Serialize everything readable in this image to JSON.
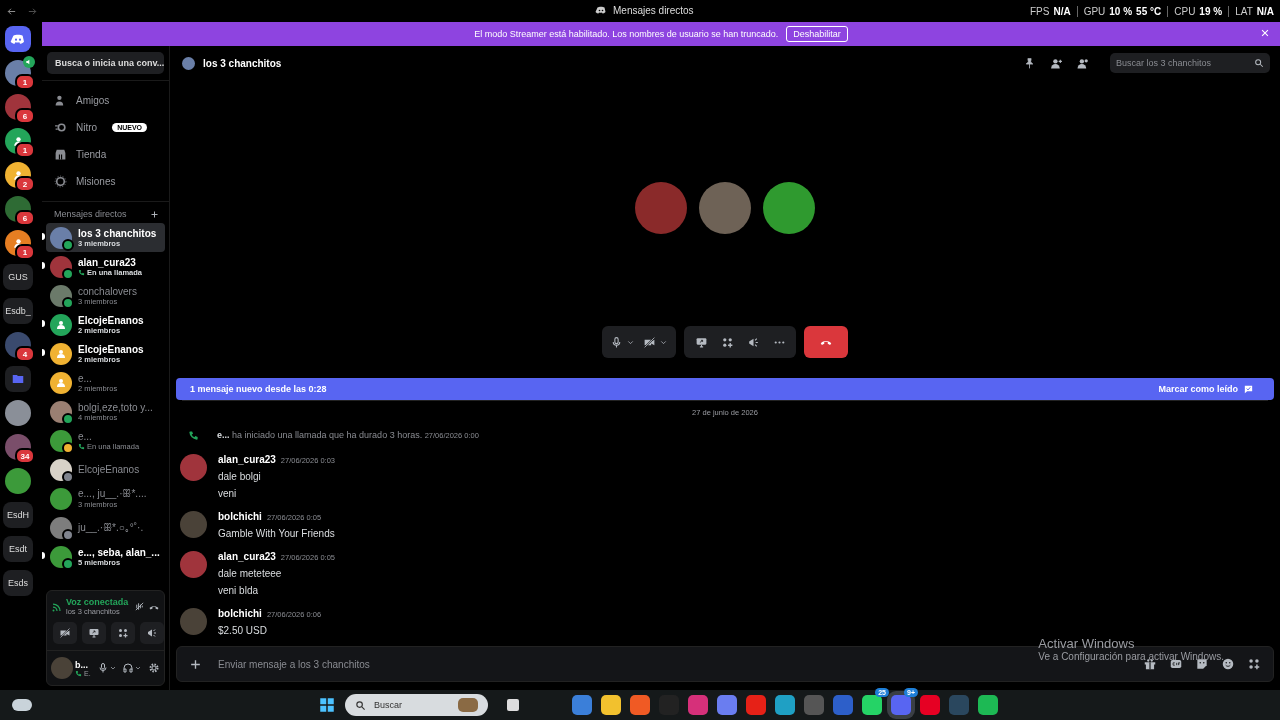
{
  "titlebar": {
    "title": "Mensajes directos",
    "stats": [
      {
        "label": "FPS",
        "values": [
          "N/A"
        ]
      },
      {
        "label": "GPU",
        "values": [
          "10 %",
          "55 °C"
        ]
      },
      {
        "label": "CPU",
        "values": [
          "19 %"
        ]
      },
      {
        "label": "LAT",
        "values": [
          "N/A"
        ]
      }
    ]
  },
  "banner": {
    "text": "El modo Streamer está habilitado. Los nombres de usuario se han truncado.",
    "button": "Deshabilitar"
  },
  "servers": [
    {
      "kind": "home",
      "selected": true
    },
    {
      "kind": "photo",
      "color": "#6a7fa8",
      "badge": "1",
      "voice": true,
      "selected": false
    },
    {
      "kind": "photo",
      "color": "#a0343c",
      "badge": "6",
      "selected": false
    },
    {
      "kind": "group",
      "color": "#23a55a",
      "badge": "1",
      "selected": false
    },
    {
      "kind": "group",
      "color": "#f0b232",
      "badge": "2",
      "selected": false
    },
    {
      "kind": "photo",
      "color": "#2e6b34",
      "badge": "6",
      "selected": false
    },
    {
      "kind": "group",
      "color": "#e67e22",
      "badge": "1",
      "selected": false
    },
    {
      "kind": "text",
      "label": "GUS",
      "selected": false
    },
    {
      "kind": "text",
      "label": "Esdb_",
      "selected": false
    },
    {
      "kind": "photo",
      "color": "#3a4a6e",
      "badge": "4",
      "selected": false
    },
    {
      "kind": "folder",
      "color": "#5865f2",
      "selected": false
    },
    {
      "kind": "photo",
      "color": "#8a8f98",
      "selected": false
    },
    {
      "kind": "photo",
      "color": "#7a4e6a",
      "badge": "34",
      "selected": false
    },
    {
      "kind": "photo",
      "color": "#3c9a3a",
      "selected": false
    },
    {
      "kind": "text",
      "label": "EsdH",
      "selected": false
    },
    {
      "kind": "text",
      "label": "Esdt",
      "selected": false
    },
    {
      "kind": "text",
      "label": "Esds",
      "selected": false
    }
  ],
  "dm_sidebar": {
    "search": "Busca o inicia una conv...",
    "nav": [
      {
        "kind": "friends",
        "label": "Amigos"
      },
      {
        "kind": "nitro",
        "label": "Nitro",
        "badge": "NUEVO"
      },
      {
        "kind": "shop",
        "label": "Tienda"
      },
      {
        "kind": "quests",
        "label": "Misiones"
      }
    ],
    "section_title": "Mensajes directos",
    "conversations": [
      {
        "kind": "photo",
        "color": "#6a7fa8",
        "name": "los 3 chanchitos",
        "subtitle": "3 miembros",
        "status_dot": {
          "color": "#23a55a"
        },
        "in_call": false,
        "unread": true,
        "selected": true
      },
      {
        "kind": "photo",
        "color": "#a0343c",
        "name": "alan_cura23",
        "subtitle": "En una llamada",
        "status_dot": {
          "color": "#23a55a"
        },
        "in_call": true,
        "unread": true,
        "selected": false
      },
      {
        "kind": "photo",
        "color": "#6b7a6a",
        "name": "conchalovers",
        "subtitle": "3 miembros",
        "status_dot": {
          "color": "#23a55a"
        },
        "in_call": false,
        "unread": false,
        "selected": false
      },
      {
        "kind": "group",
        "color": "#23a55a",
        "name": "ElcojeEnanos",
        "subtitle": "2 miembros",
        "in_call": false,
        "unread": true,
        "selected": false
      },
      {
        "kind": "group",
        "color": "#f0b232",
        "name": "ElcojeEnanos",
        "subtitle": "2 miembros",
        "in_call": false,
        "unread": true,
        "selected": false
      },
      {
        "kind": "group",
        "color": "#f0b232",
        "name": "e...",
        "subtitle": "2 miembros",
        "in_call": false,
        "unread": false,
        "selected": false
      },
      {
        "kind": "photo",
        "color": "#9a7f72",
        "name": "bolgi,eze,toto y...",
        "subtitle": "4 miembros",
        "status_dot": {
          "color": "#23a55a"
        },
        "in_call": false,
        "unread": false,
        "selected": false
      },
      {
        "kind": "photo",
        "color": "#3c9a3a",
        "name": "e...",
        "subtitle": "En una llamada",
        "status_dot": {
          "color": "#f0b232"
        },
        "in_call": true,
        "unread": false,
        "selected": false
      },
      {
        "kind": "photo",
        "color": "#d8d2c8",
        "name": "ElcojeEnanos",
        "status_dot": {
          "color": "#80848e"
        },
        "unread": false,
        "selected": false
      },
      {
        "kind": "photo",
        "color": "#3c9a3a",
        "name": "e..., ju__.·ꕥ*....",
        "subtitle": "3 miembros",
        "in_call": false,
        "unread": false,
        "selected": false
      },
      {
        "kind": "photo",
        "color": "#7d7d7d",
        "name": "ju__.·ꕥ*.○｡°˚·.",
        "status_dot": {
          "color": "#80848e"
        },
        "unread": false,
        "selected": false
      },
      {
        "kind": "photo",
        "color": "#3c9a3a",
        "name": "e..., seba, alan_...",
        "subtitle": "5 miembros",
        "status_dot": {
          "color": "#23a55a"
        },
        "in_call": false,
        "unread": true,
        "selected": false
      }
    ]
  },
  "voice_panel": {
    "status": "Voz conectada",
    "channel": "los 3 chanchitos"
  },
  "user_panel": {
    "name": "b...",
    "activity": "E."
  },
  "channel_header": {
    "title": "los 3 chanchitos",
    "search_placeholder": "Buscar los 3 chanchitos"
  },
  "call": {
    "participants": [
      {
        "color": "#8a2a2a"
      },
      {
        "color": "#6e6256"
      },
      {
        "color": "#2f9a2f"
      }
    ]
  },
  "new_messages_bar": {
    "text": "1 mensaje nuevo desde las 0:28",
    "action": "Marcar como leído"
  },
  "messages": {
    "date": "27 de junio de 2026",
    "items": [
      {
        "kind": "call",
        "author": "e...",
        "text": "ha iniciado una llamada que ha durado 3 horas.",
        "time": "27/06/2026 0:00"
      },
      {
        "kind": "message",
        "author": "alan_cura23",
        "time": "27/06/2026 0:03",
        "lines": [
          "dale bolgi",
          "veni"
        ],
        "color": "#a0343c"
      },
      {
        "kind": "message",
        "author": "bolchichi",
        "time": "27/06/2026 0:05",
        "lines": [
          "Gamble With Your Friends"
        ],
        "color": "#4a4238"
      },
      {
        "kind": "message",
        "author": "alan_cura23",
        "time": "27/06/2026 0:05",
        "lines": [
          "dale meteteee",
          "veni blda"
        ],
        "color": "#a0343c"
      },
      {
        "kind": "message",
        "author": "bolchichi",
        "time": "27/06/2026 0:06",
        "lines": [
          "$2.50 USD"
        ],
        "color": "#4a4238"
      }
    ]
  },
  "composer": {
    "placeholder": "Enviar mensaje a los 3 chanchitos"
  },
  "windows_notice": {
    "title": "Activar Windows",
    "text": "Ve a Configuración para activar Windows."
  },
  "taskbar": {
    "search_placeholder": "Buscar",
    "apps": [
      {
        "color": "#3b7fd9"
      },
      {
        "color": "#f2c12e"
      },
      {
        "color": "#f05a24"
      },
      {
        "color": "#222222"
      },
      {
        "color": "#d6307a"
      },
      {
        "color": "#6a7df0"
      },
      {
        "color": "#e62117"
      },
      {
        "color": "#1fa0c4"
      },
      {
        "color": "#555555"
      },
      {
        "color": "#2d5fc9"
      },
      {
        "color": "#25d366",
        "badge": "25"
      },
      {
        "color": "#5865f2",
        "badge": "9+",
        "selected": true
      },
      {
        "color": "#e60023"
      },
      {
        "color": "#2a475e"
      },
      {
        "color": "#1db954"
      }
    ]
  }
}
